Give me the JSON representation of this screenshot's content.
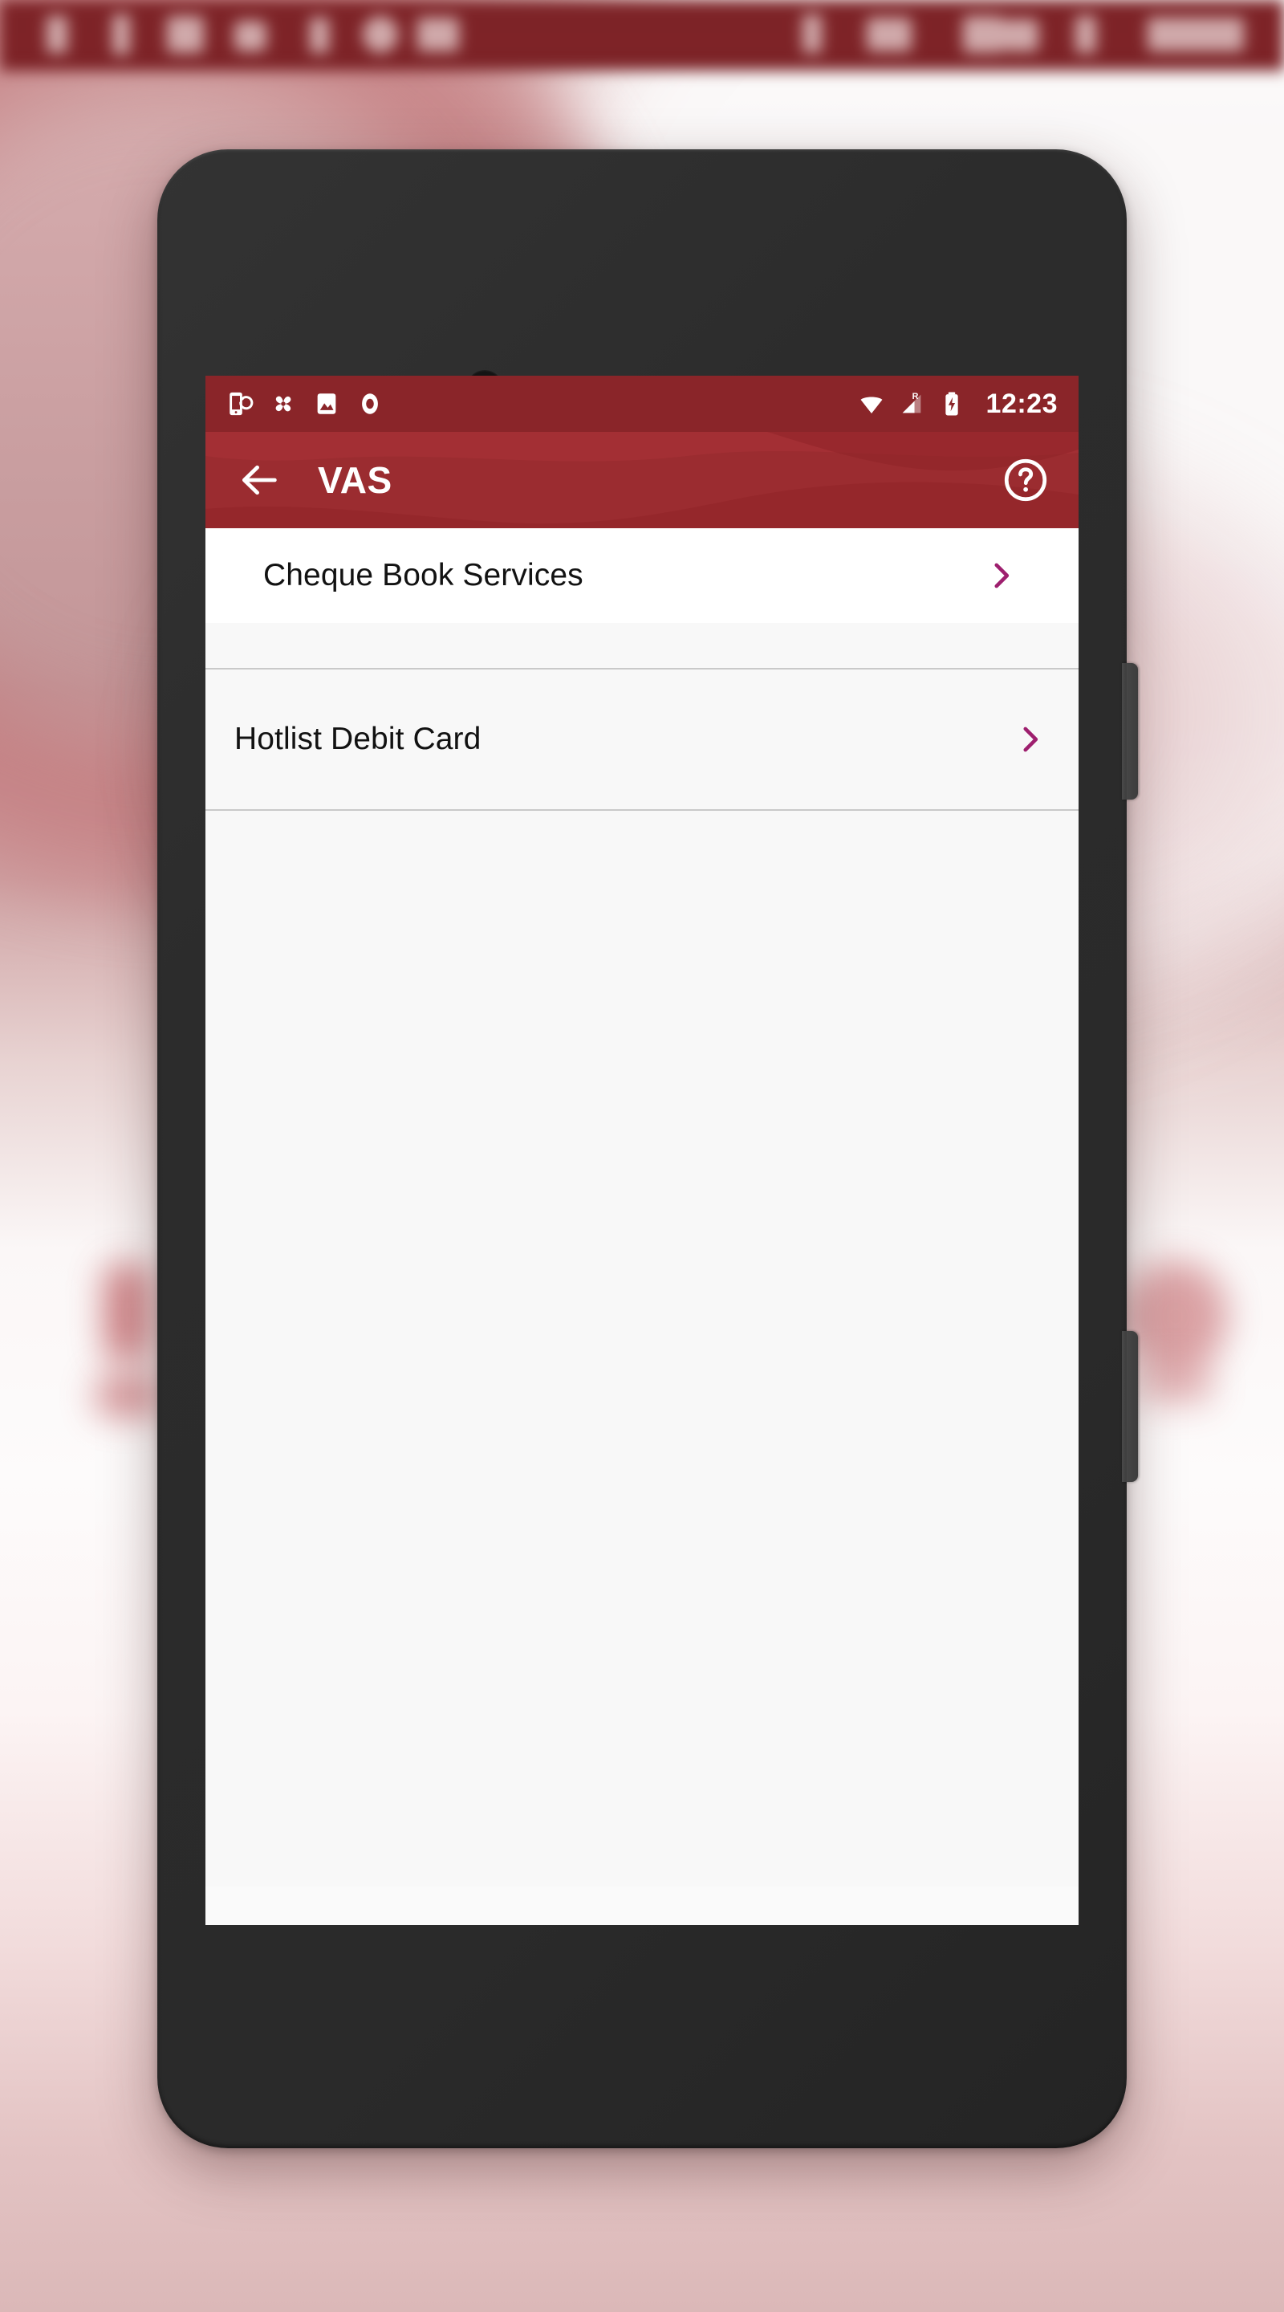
{
  "host_status_bar": {
    "visible": true,
    "blurred": true,
    "background_color": "#7d2327",
    "left_icons": [
      "sync-icon",
      "battery-icon",
      "image-icon",
      "folder-icon",
      "signal-icon",
      "camera-icon",
      "window-icon"
    ],
    "right_icons": [
      "battery-icon",
      "wifi-icon",
      "cast-icon",
      "battery-icon"
    ],
    "clock": "4:27"
  },
  "device": {
    "frame_color": "#2c2c2c",
    "buttons": [
      "power-button",
      "volume-button"
    ],
    "wallpaper_colors": [
      "#d9b6b6",
      "#c3969a",
      "#fdfbfb",
      "#e3c3c3"
    ]
  },
  "status_bar": {
    "background_color": "#8a2529",
    "left_icons": [
      "sync-phone-icon",
      "pinwheel-icon",
      "image-icon",
      "record-circle-icon"
    ],
    "right_icons": [
      "wifi-icon",
      "signal-roaming-icon",
      "battery-charging-icon"
    ],
    "roaming_label": "R",
    "clock": "12:23"
  },
  "app_bar": {
    "background_color": "#9b2c30",
    "back_icon": "arrow-back-icon",
    "title": "VAS",
    "help_icon": "help-circle-icon"
  },
  "theme": {
    "accent_red": "#9b2c30",
    "status_red": "#8a2529",
    "chevron_magenta": "#9e1f6e",
    "list_bg": "#f8f8f8",
    "row_bg": "#ffffff",
    "divider": "#c9c9c9",
    "decor_circle": "#d4d4d4",
    "text_primary": "#121212"
  },
  "list": {
    "chevron_icon": "chevron-right-icon",
    "items": [
      {
        "label": "Cheque Book Services",
        "chevron": "chevron-right-icon"
      },
      {
        "label": "Hotlist Debit Card",
        "chevron": "chevron-right-icon"
      }
    ]
  }
}
